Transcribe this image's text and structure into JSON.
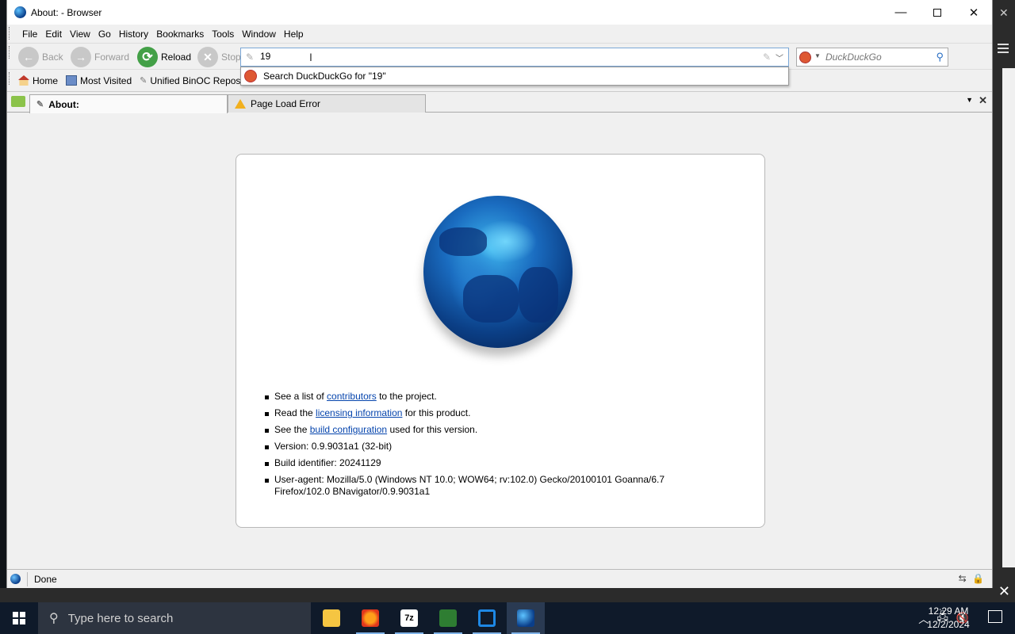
{
  "window": {
    "title": "About: - Browser",
    "minimize": "—",
    "close": "✕"
  },
  "menu": [
    "File",
    "Edit",
    "View",
    "Go",
    "History",
    "Bookmarks",
    "Tools",
    "Window",
    "Help"
  ],
  "nav": {
    "back": "Back",
    "forward": "Forward",
    "reload": "Reload",
    "stop": "Stop"
  },
  "urlbar": {
    "value": "19",
    "suggestion": "Search DuckDuckGo for \"19\""
  },
  "search": {
    "placeholder": "DuckDuckGo"
  },
  "bookmarks": [
    "Home",
    "Most Visited",
    "Unified BinOC Reposi"
  ],
  "tabs": [
    {
      "label": "About:",
      "active": true
    },
    {
      "label": "Page Load Error",
      "active": false
    }
  ],
  "about": {
    "line1_pre": "See a list of ",
    "line1_link": "contributors",
    "line1_post": " to the project.",
    "line2_pre": "Read the ",
    "line2_link": "licensing information",
    "line2_post": " for this product.",
    "line3_pre": "See the ",
    "line3_link": "build configuration",
    "line3_post": " used for this version.",
    "version": "Version: 0.9.9031a1 (32-bit)",
    "build": "Build identifier: 20241129",
    "useragent": "User-agent: Mozilla/5.0 (Windows NT 10.0; WOW64; rv:102.0) Gecko/20100101 Goanna/6.7 Firefox/102.0 BNavigator/0.9.9031a1"
  },
  "status": {
    "text": "Done"
  },
  "taskbar": {
    "search_placeholder": "Type here to search",
    "apps": [
      "file-explorer",
      "firefox",
      "7-zip",
      "eclipse",
      "virtualbox",
      "browser"
    ],
    "time": "12:29 AM",
    "date": "12/2/2024"
  },
  "colors": {
    "link": "#0645ad",
    "taskbar": "#0f1a2a"
  }
}
